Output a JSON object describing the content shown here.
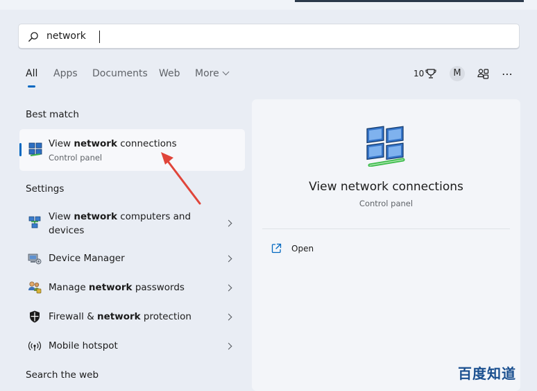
{
  "search": {
    "value": "network"
  },
  "tabs": [
    {
      "label": "All"
    },
    {
      "label": "Apps"
    },
    {
      "label": "Documents"
    },
    {
      "label": "Web"
    },
    {
      "label": "More"
    }
  ],
  "header_tools": {
    "count": "10",
    "avatar_letter": "M"
  },
  "sections": {
    "best_match": "Best match",
    "settings": "Settings",
    "search_web": "Search the web"
  },
  "best_match": {
    "title_pre": "View ",
    "title_bold": "network",
    "title_post": " connections",
    "subtitle": "Control panel"
  },
  "settings": [
    {
      "pre": "View ",
      "bold": "network",
      "post": " computers and",
      "line2": "devices",
      "icon": "network-computers-icon"
    },
    {
      "pre": "Device Manager",
      "bold": "",
      "post": "",
      "icon": "device-manager-icon"
    },
    {
      "pre": "Manage ",
      "bold": "network",
      "post": " passwords",
      "icon": "credential-manager-icon"
    },
    {
      "pre": "Firewall & ",
      "bold": "network",
      "post": " protection",
      "icon": "shield-icon"
    },
    {
      "pre": "Mobile hotspot",
      "bold": "",
      "post": "",
      "icon": "hotspot-icon"
    }
  ],
  "preview": {
    "title": "View network connections",
    "subtitle": "Control panel",
    "actions": [
      {
        "label": "Open",
        "icon": "open-external-icon"
      }
    ]
  },
  "watermark": "百度知道",
  "colors": {
    "accent": "#0067c0",
    "annotation_arrow": "#e0453a"
  }
}
